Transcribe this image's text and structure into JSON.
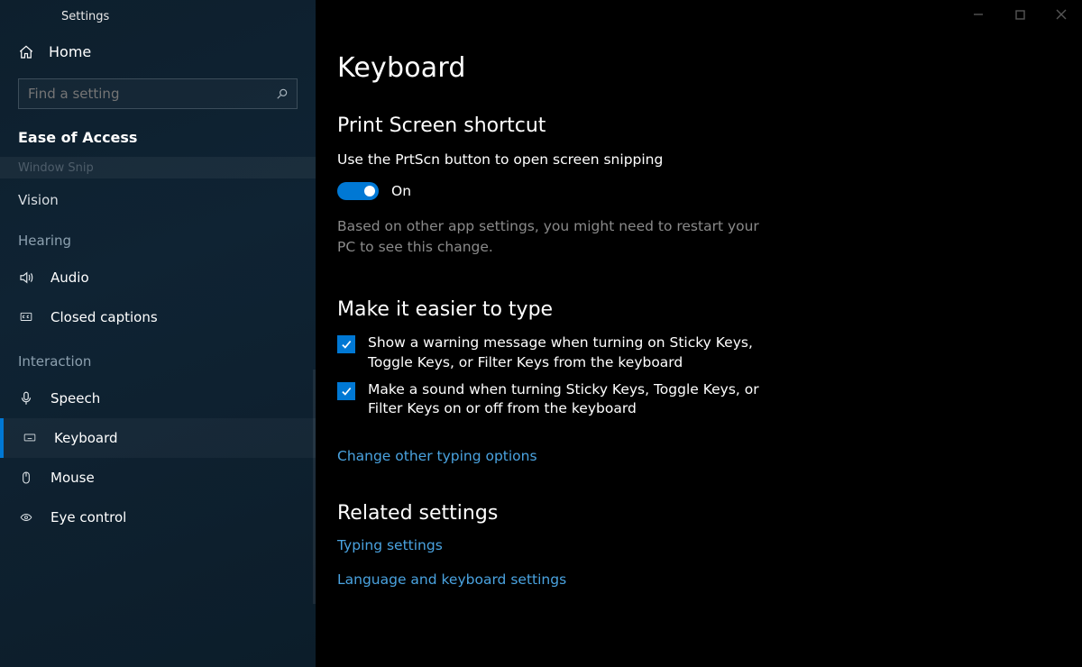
{
  "window": {
    "title": "Settings"
  },
  "sidebar": {
    "home_label": "Home",
    "search_placeholder": "Find a setting",
    "category": "Ease of Access",
    "ghost_label": "Window Snip",
    "groups": [
      {
        "label": "Vision",
        "is_label_only": true
      },
      {
        "label": "Hearing",
        "items": [
          {
            "id": "audio",
            "label": "Audio",
            "icon": "speaker"
          },
          {
            "id": "closed-captions",
            "label": "Closed captions",
            "icon": "captions"
          }
        ]
      },
      {
        "label": "Interaction",
        "items": [
          {
            "id": "speech",
            "label": "Speech",
            "icon": "mic"
          },
          {
            "id": "keyboard",
            "label": "Keyboard",
            "icon": "keyboard",
            "selected": true
          },
          {
            "id": "mouse",
            "label": "Mouse",
            "icon": "mouse"
          },
          {
            "id": "eye-control",
            "label": "Eye control",
            "icon": "eye"
          }
        ]
      }
    ]
  },
  "main": {
    "title": "Keyboard",
    "sections": {
      "prtscn": {
        "heading": "Print Screen shortcut",
        "desc": "Use the PrtScn button to open screen snipping",
        "toggle_state": "On",
        "note": "Based on other app settings, you might need to restart your PC to see this change."
      },
      "easier": {
        "heading": "Make it easier to type",
        "checks": [
          "Show a warning message when turning on Sticky Keys, Toggle Keys, or Filter Keys from the keyboard",
          "Make a sound when turning Sticky Keys, Toggle Keys, or Filter Keys on or off from the keyboard"
        ],
        "link": "Change other typing options"
      },
      "related": {
        "heading": "Related settings",
        "links": [
          "Typing settings",
          "Language and keyboard settings"
        ]
      }
    }
  }
}
